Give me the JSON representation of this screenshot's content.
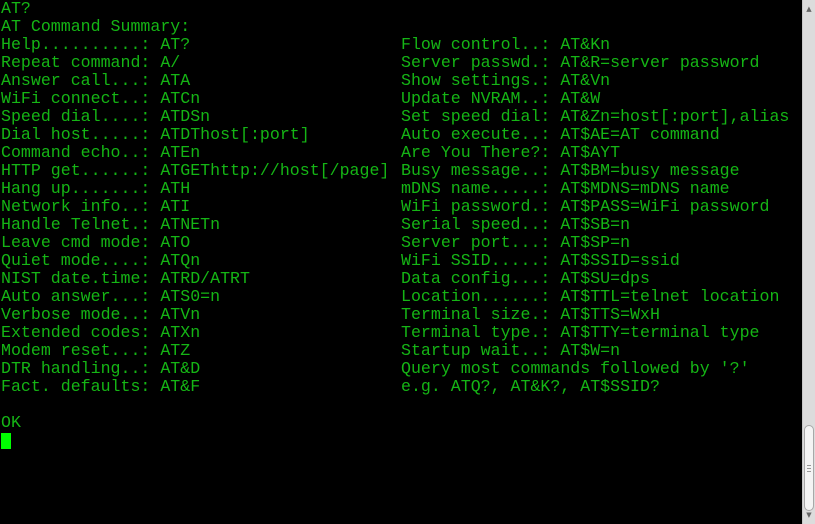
{
  "terminal": {
    "command": "AT?",
    "heading": "AT Command Summary:",
    "left_column": [
      "Help..........: AT?",
      "Repeat command: A/",
      "Answer call...: ATA",
      "WiFi connect..: ATCn",
      "Speed dial....: ATDSn",
      "Dial host.....: ATDThost[:port]",
      "Command echo..: ATEn",
      "HTTP get......: ATGEThttp://host[/page]",
      "Hang up.......: ATH",
      "Network info..: ATI",
      "Handle Telnet.: ATNETn",
      "Leave cmd mode: ATO",
      "Quiet mode....: ATQn",
      "NIST date.time: ATRD/ATRT",
      "Auto answer...: ATS0=n",
      "Verbose mode..: ATVn",
      "Extended codes: ATXn",
      "Modem reset...: ATZ",
      "DTR handling..: AT&D",
      "Fact. defaults: AT&F"
    ],
    "right_column": [
      "Flow control..: AT&Kn",
      "Server passwd.: AT&R=server password",
      "Show settings.: AT&Vn",
      "Update NVRAM..: AT&W",
      "Set speed dial: AT&Zn=host[:port],alias",
      "Auto execute..: AT$AE=AT command",
      "Are You There?: AT$AYT",
      "Busy message..: AT$BM=busy message",
      "mDNS name.....: AT$MDNS=mDNS name",
      "WiFi password.: AT$PASS=WiFi password",
      "Serial speed..: AT$SB=n",
      "Server port...: AT$SP=n",
      "WiFi SSID.....: AT$SSID=ssid",
      "Data config...: AT$SU=dps",
      "Location......: AT$TTL=telnet location",
      "Terminal size.: AT$TTS=WxH",
      "Terminal type.: AT$TTY=terminal type",
      "Startup wait..: AT$W=n",
      "Query most commands followed by '?'",
      "e.g. ATQ?, AT&K?, AT$SSID?"
    ],
    "status": "OK",
    "colors": {
      "text": "#15b515",
      "cursor": "#00ff00",
      "background": "#000000"
    }
  },
  "scrollbar": {
    "up_icon": "▲",
    "down_icon": "▼",
    "position_percent": 100
  }
}
